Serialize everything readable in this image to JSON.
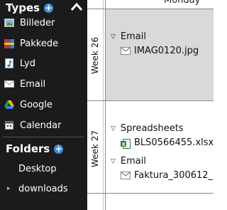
{
  "sidebar": {
    "types_title": "Types",
    "types": [
      {
        "label": "Billeder",
        "icon": "image-icon"
      },
      {
        "label": "Pakkede",
        "icon": "archive-icon"
      },
      {
        "label": "Lyd",
        "icon": "music-note-icon"
      },
      {
        "label": "Email",
        "icon": "envelope-icon"
      },
      {
        "label": "Google",
        "icon": "google-drive-icon"
      },
      {
        "label": "Calendar",
        "icon": "calendar-icon"
      }
    ],
    "folders_title": "Folders",
    "folders": [
      {
        "label": "Desktop"
      },
      {
        "label": "downloads"
      }
    ]
  },
  "calendar": {
    "day_header": "Monday",
    "weeks": [
      {
        "label": "Week 26",
        "groups": [
          {
            "title": "Email",
            "items": [
              {
                "name": "IMAG0120.jpg",
                "icon": "envelope-icon"
              }
            ]
          }
        ]
      },
      {
        "label": "Week 27",
        "groups": [
          {
            "title": "Spreadsheets",
            "items": [
              {
                "name": "BLS0566455.xlsx",
                "icon": "excel-file-icon"
              }
            ]
          },
          {
            "title": "Email",
            "items": [
              {
                "name": "Faktura_300612_",
                "icon": "envelope-icon"
              }
            ]
          }
        ]
      }
    ]
  },
  "colors": {
    "sidebar_bg": "#1b1b1b",
    "accent_plus": "#3f8edb",
    "week_highlight": "#d9d9d9"
  }
}
